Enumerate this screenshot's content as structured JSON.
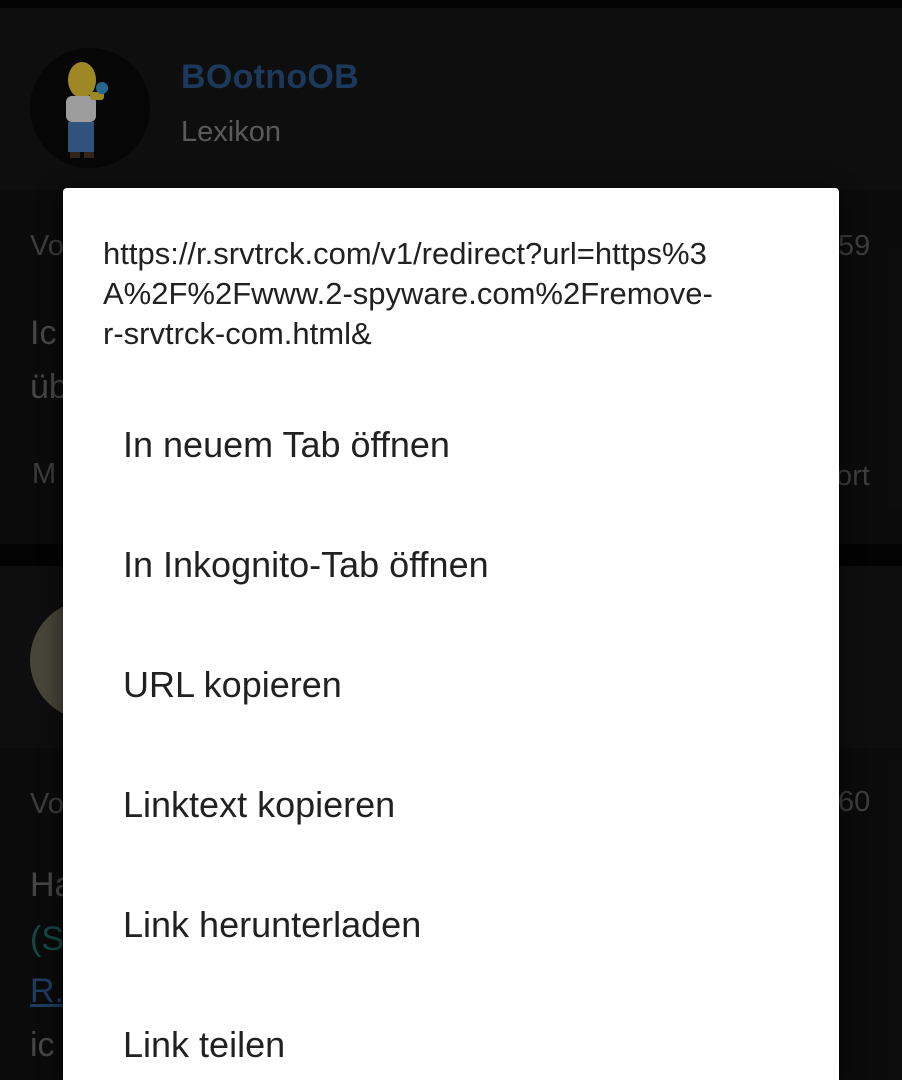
{
  "background": {
    "post1": {
      "username": "BOotnoOB",
      "rank": "Lexikon",
      "meta_left": "Vo",
      "meta_right": "59",
      "body_line1": "Ic",
      "body_line2": "üb",
      "footer_left": "M",
      "footer_right": "ort"
    },
    "post2": {
      "meta_left": "Vo",
      "meta_right": "60",
      "body_line1": "Ha",
      "body_line2": "(S",
      "body_line3": "R.",
      "body_line4": "ic"
    }
  },
  "context_menu": {
    "url": "https://r.srvtrck.com/v1/redirect?url=https%3A%2F%2Fwww.2-spyware.com%2Fremove-r-srvtrck-com.html&",
    "items": [
      {
        "label": "In neuem Tab öffnen"
      },
      {
        "label": "In Inkognito-Tab öffnen"
      },
      {
        "label": "URL kopieren"
      },
      {
        "label": "Linktext kopieren"
      },
      {
        "label": "Link herunterladen"
      },
      {
        "label": "Link teilen"
      }
    ]
  }
}
